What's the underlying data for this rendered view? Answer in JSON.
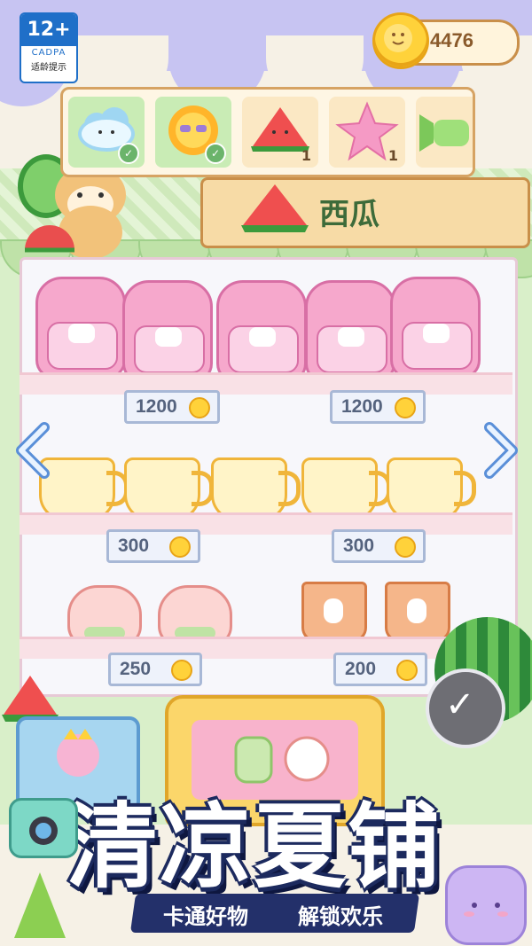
{
  "age_rating": {
    "number": "12+",
    "org": "CADPA",
    "tip": "适龄提示"
  },
  "coins": {
    "icon": "coin-icon",
    "value": "4476"
  },
  "selector": {
    "items": [
      {
        "name": "cloud",
        "icon": "cloud-icon",
        "status": "owned"
      },
      {
        "name": "sun",
        "icon": "sun-icon",
        "status": "owned"
      },
      {
        "name": "watermelon",
        "icon": "watermelon-icon",
        "count": "1"
      },
      {
        "name": "star",
        "icon": "star-icon",
        "count": "1"
      },
      {
        "name": "candy",
        "icon": "candy-icon"
      }
    ]
  },
  "banner": {
    "label": "西瓜",
    "icon": "watermelon-slice-icon"
  },
  "shelves": [
    {
      "product": "backpack",
      "prices": [
        "1200",
        "1200"
      ]
    },
    {
      "product": "cat-mug",
      "prices": [
        "300",
        "300"
      ]
    },
    {
      "left_product": "teapot",
      "right_product": "rabbit-cup",
      "prices": [
        "250",
        "200"
      ]
    }
  ],
  "nav": {
    "left": "chevron-left-icon",
    "right": "chevron-right-icon"
  },
  "confirm_button": {
    "icon": "check-icon"
  },
  "promo": {
    "title": "清凉夏铺",
    "sub_left": "卡通好物",
    "sub_right": "解锁欢乐"
  },
  "colors": {
    "awning": "#c7c4f2",
    "wall": "#d9efc9",
    "coin": "#ffd23a",
    "title_outline": "#1c2a5e",
    "price_text": "#55637e"
  }
}
